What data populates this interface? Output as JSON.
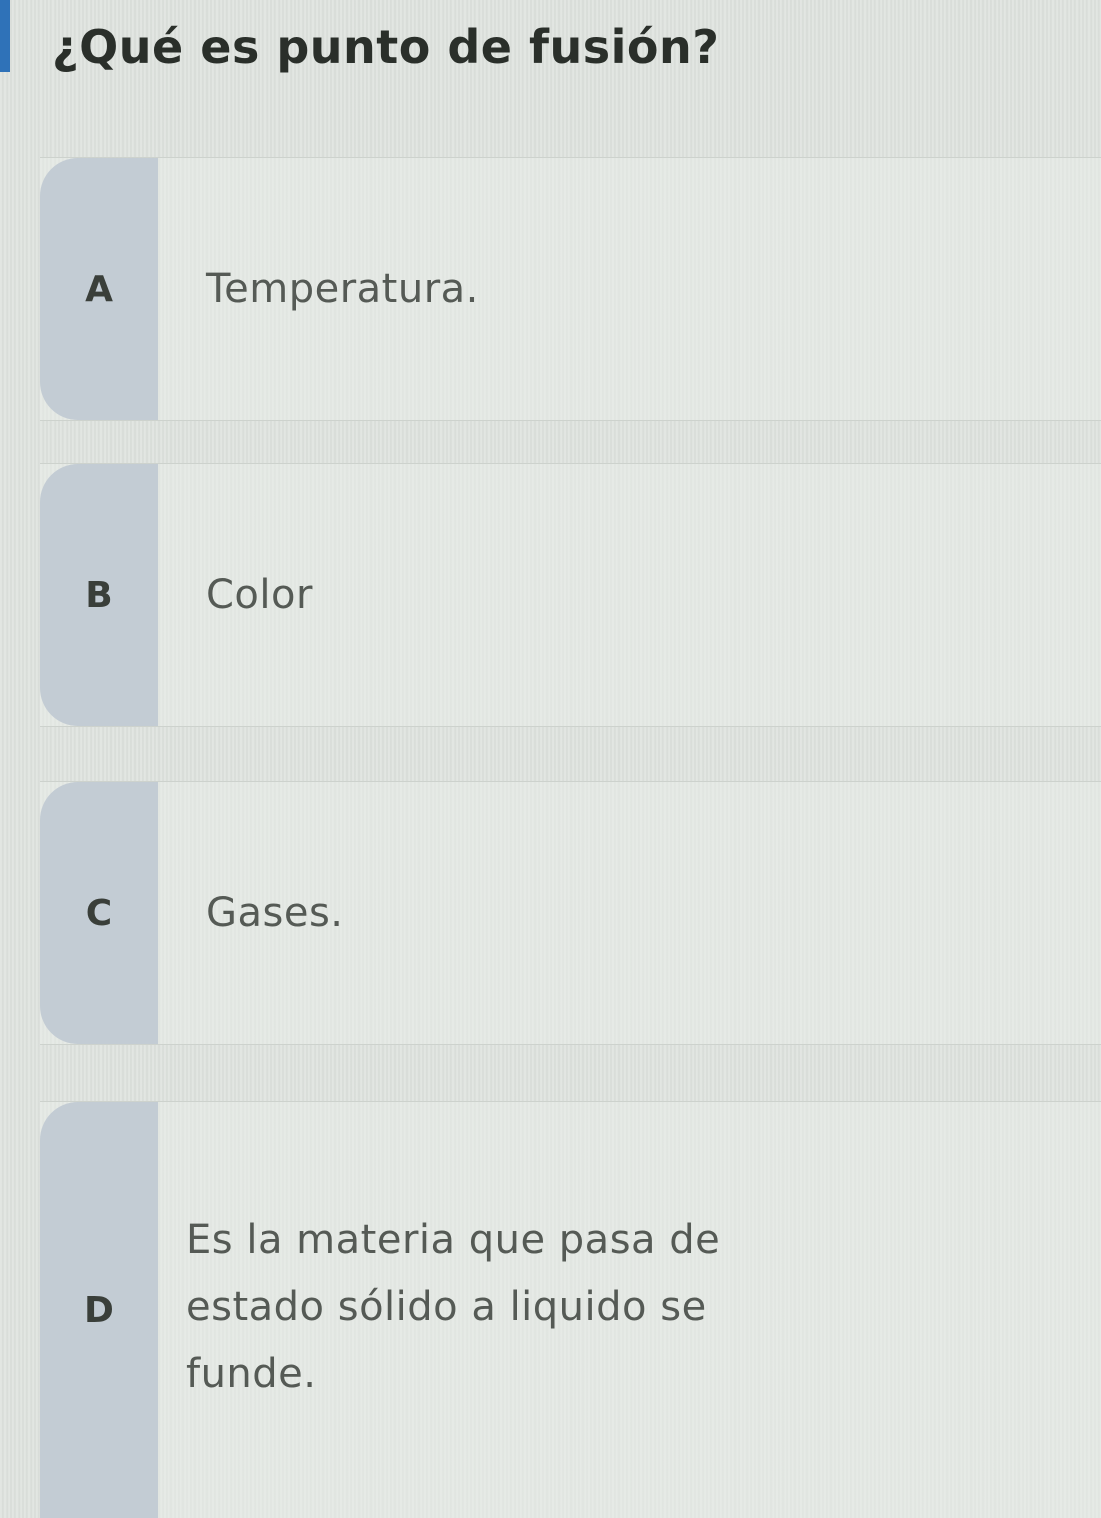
{
  "question": "¿Qué es punto de fusión?",
  "options": [
    {
      "letter": "A",
      "text": "Temperatura."
    },
    {
      "letter": "B",
      "text": "Color"
    },
    {
      "letter": "C",
      "text": "Gases."
    },
    {
      "letter": "D",
      "text": "Es la materia que pasa de estado sólido a liquido se funde."
    }
  ],
  "colors": {
    "accent_bar": "#2f72b8",
    "letter_box": "#c3ccd4",
    "background": "#dfe3df"
  }
}
